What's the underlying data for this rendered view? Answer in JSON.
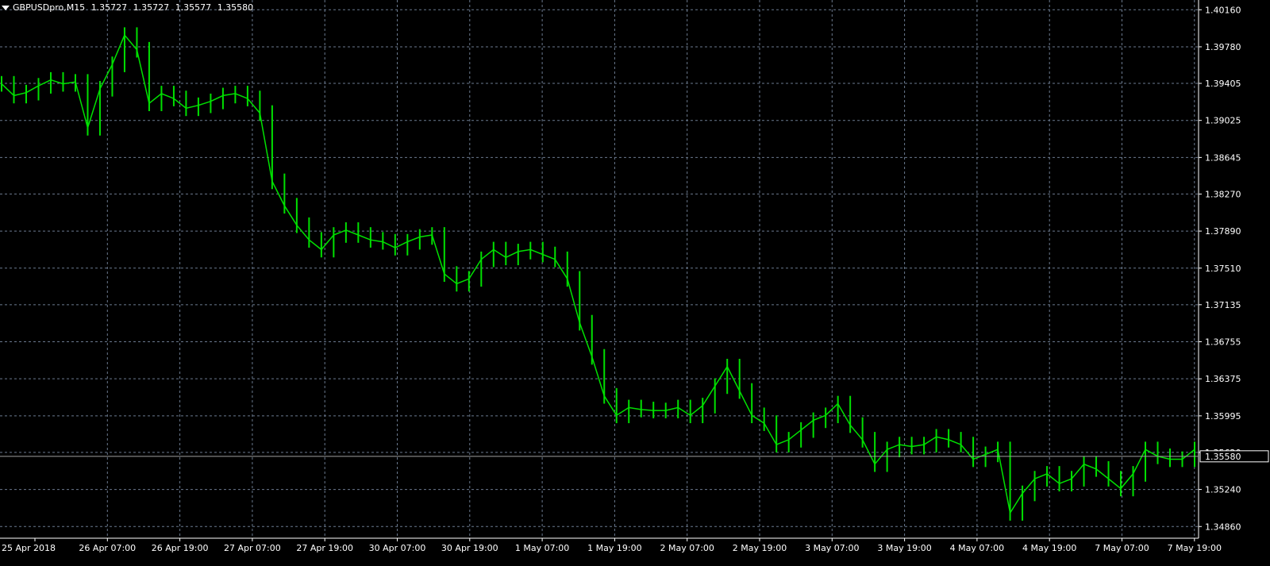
{
  "header": {
    "symbol": "GBPUSDpro,M15",
    "open": "1.35727",
    "high": "1.35727",
    "low": "1.35577",
    "close": "1.35580"
  },
  "colors": {
    "background": "#000000",
    "grid": "#6b7a8f",
    "candle": "#00e000",
    "axis_text": "#ffffff",
    "bid_line": "#a0a0a0"
  },
  "chart_data": {
    "type": "line",
    "title": "GBPUSDpro,M15",
    "xlabel": "",
    "ylabel": "",
    "grid": true,
    "ylim": [
      1.3474,
      1.4026
    ],
    "y_ticks": [
      "1.40160",
      "1.39780",
      "1.39405",
      "1.39025",
      "1.38645",
      "1.38270",
      "1.37890",
      "1.37510",
      "1.37135",
      "1.36755",
      "1.36375",
      "1.35995",
      "1.35620",
      "1.35240",
      "1.34860"
    ],
    "x_ticks": [
      "25 Apr 2018",
      "26 Apr 07:00",
      "26 Apr 19:00",
      "27 Apr 07:00",
      "27 Apr 19:00",
      "30 Apr 07:00",
      "30 Apr 19:00",
      "1 May 07:00",
      "1 May 19:00",
      "2 May 07:00",
      "2 May 19:00",
      "3 May 07:00",
      "3 May 19:00",
      "4 May 07:00",
      "4 May 19:00",
      "7 May 07:00",
      "7 May 19:00"
    ],
    "current_price_label": "1.35580",
    "current_price": 1.3558,
    "series": [
      {
        "values": [
          1.394,
          1.3928,
          1.3931,
          1.3938,
          1.3944,
          1.394,
          1.3942,
          1.3895,
          1.3935,
          1.396,
          1.399,
          1.3975,
          1.392,
          1.393,
          1.3925,
          1.3915,
          1.3918,
          1.3922,
          1.3928,
          1.393,
          1.3925,
          1.391,
          1.384,
          1.3815,
          1.3795,
          1.378,
          1.377,
          1.3785,
          1.379,
          1.3785,
          1.378,
          1.3778,
          1.3772,
          1.3778,
          1.3783,
          1.3785,
          1.3745,
          1.3735,
          1.374,
          1.376,
          1.377,
          1.3762,
          1.3768,
          1.377,
          1.3765,
          1.376,
          1.374,
          1.3695,
          1.366,
          1.362,
          1.36,
          1.3608,
          1.3606,
          1.3605,
          1.3605,
          1.3608,
          1.36,
          1.361,
          1.363,
          1.365,
          1.3625,
          1.36,
          1.3592,
          1.357,
          1.3575,
          1.3585,
          1.3595,
          1.36,
          1.3612,
          1.359,
          1.3575,
          1.355,
          1.3565,
          1.357,
          1.3568,
          1.357,
          1.3578,
          1.3575,
          1.357,
          1.3555,
          1.356,
          1.3565,
          1.35,
          1.352,
          1.3535,
          1.354,
          1.353,
          1.3535,
          1.355,
          1.3545,
          1.3535,
          1.3525,
          1.354,
          1.3565,
          1.3558,
          1.3555,
          1.3555,
          1.3565
        ]
      }
    ]
  }
}
